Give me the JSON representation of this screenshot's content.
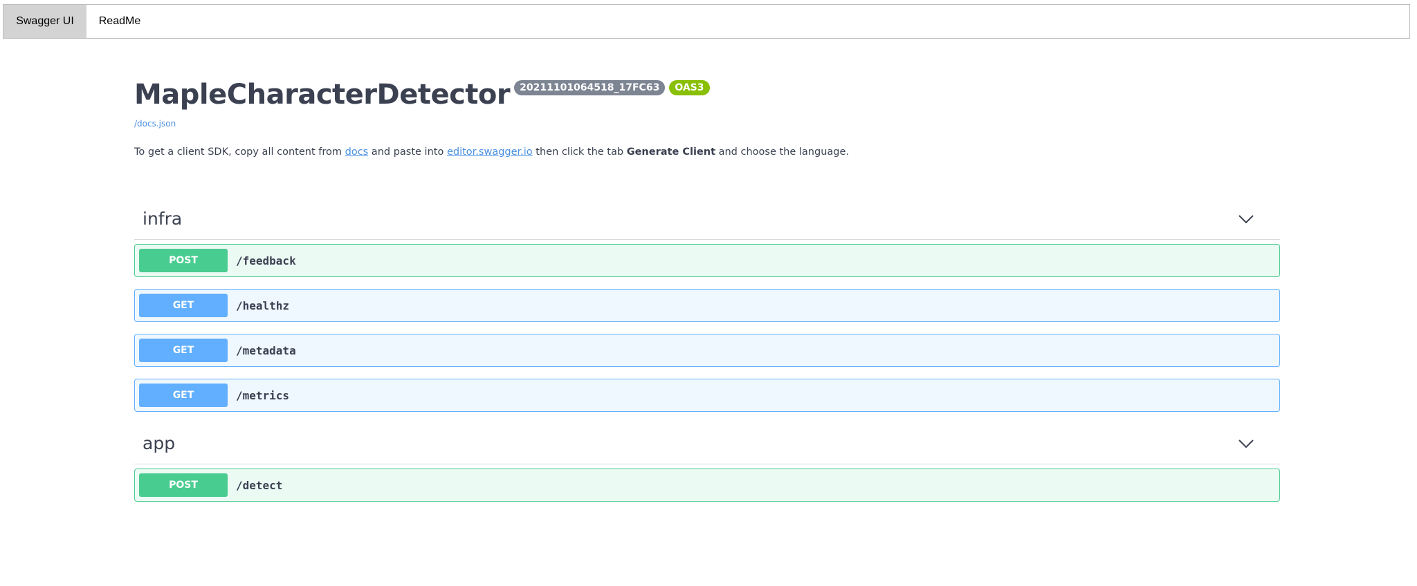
{
  "topbar": {
    "tabs": [
      {
        "label": "Swagger UI"
      },
      {
        "label": "ReadMe"
      }
    ]
  },
  "info": {
    "title": "MapleCharacterDetector",
    "version_badge": "20211101064518_17FC63",
    "oas_badge": "OAS3",
    "docs_link": "/docs.json",
    "desc_part1": "To get a client SDK, copy all content from ",
    "desc_link1": "docs",
    "desc_part2": " and paste into ",
    "desc_link2": "editor.swagger.io",
    "desc_part3": " then click the tab ",
    "desc_bold": "Generate Client",
    "desc_part4": " and choose the language."
  },
  "sections": [
    {
      "tag": "infra",
      "ops": [
        {
          "method": "POST",
          "path": "/feedback"
        },
        {
          "method": "GET",
          "path": "/healthz"
        },
        {
          "method": "GET",
          "path": "/metadata"
        },
        {
          "method": "GET",
          "path": "/metrics"
        }
      ]
    },
    {
      "tag": "app",
      "ops": [
        {
          "method": "POST",
          "path": "/detect"
        }
      ]
    }
  ],
  "colors": {
    "post": "#49cc90",
    "get": "#61affe",
    "version_badge": "#7d8492",
    "oas_badge": "#89bf04",
    "link": "#4990e2"
  },
  "icons": {
    "section_toggle": "chevron-down-icon"
  }
}
